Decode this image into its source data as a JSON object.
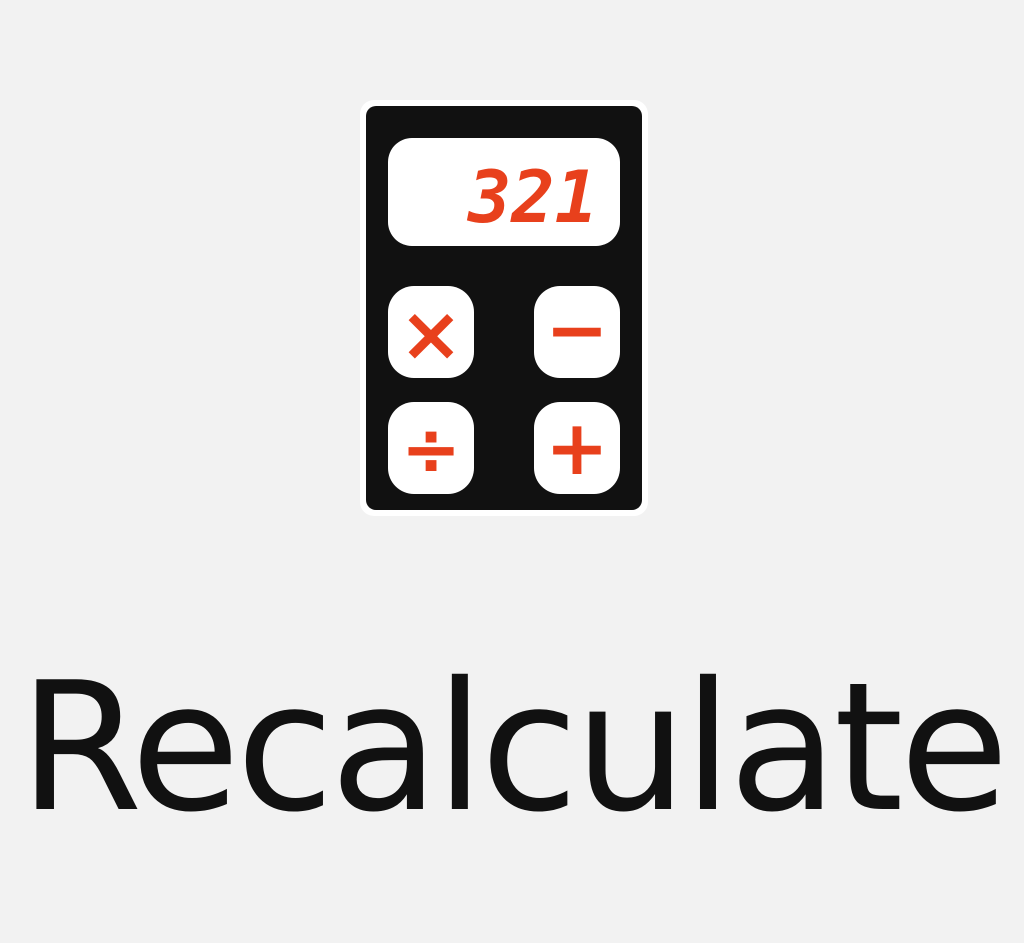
{
  "button": {
    "label": "Recalculate",
    "icon": "calculator-icon"
  },
  "calculator": {
    "display_text": "321",
    "keys": [
      "×",
      "−",
      "÷",
      "+"
    ]
  },
  "colors": {
    "background": "#f2f2f2",
    "icon_body": "#111111",
    "icon_accent": "#e8401c",
    "label": "#111111"
  }
}
